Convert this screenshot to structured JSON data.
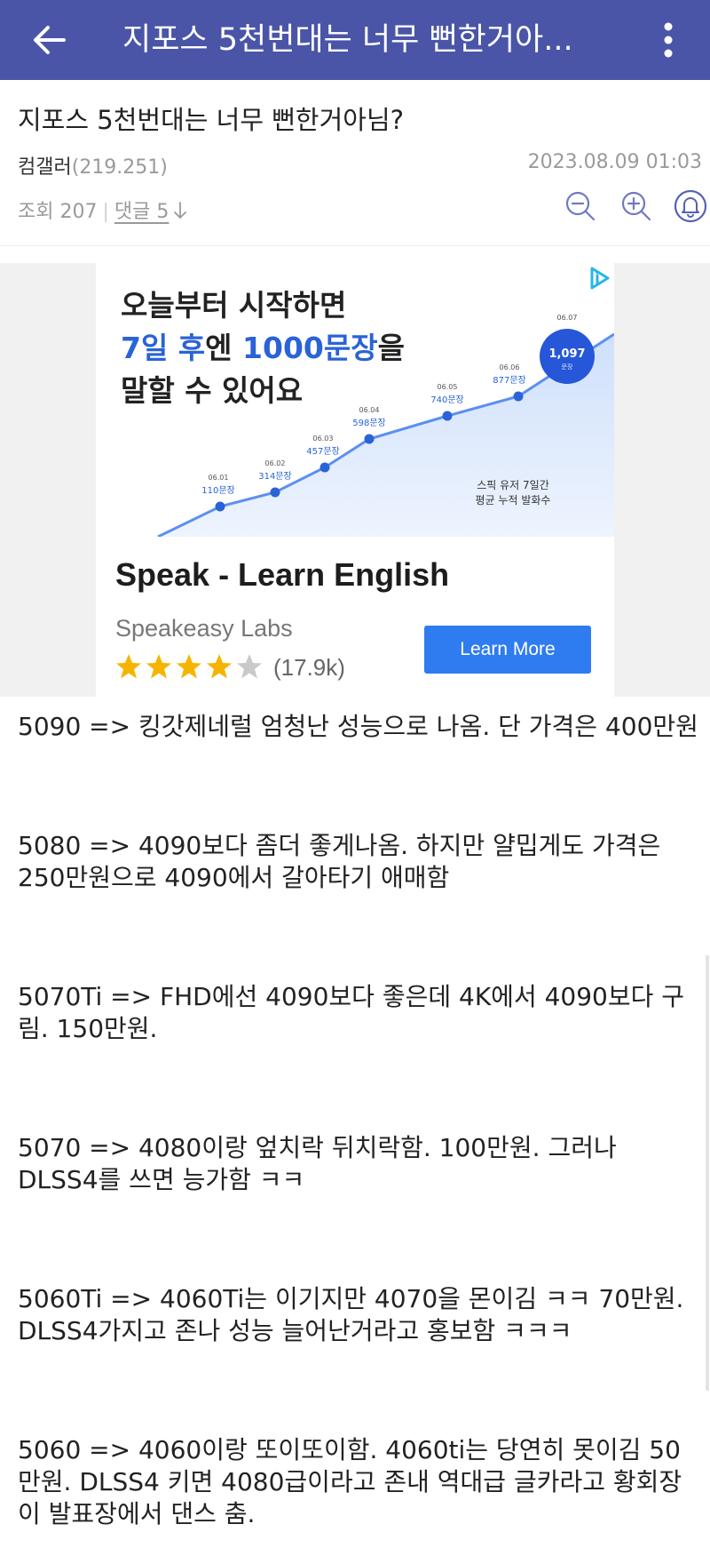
{
  "header": {
    "title": "지포스 5천번대는 너무 뻔한거아...",
    "bg_color": "#4a55a8"
  },
  "post": {
    "title": "지포스 5천번대는 너무 뻔한거아님?",
    "author": "컴갤러",
    "author_points": "(219.251)",
    "date": "2023.08.09 01:03",
    "views": "조회 207",
    "comments": "댓글 5",
    "comments_icon": "arrow-down-icon"
  },
  "toolbar_icons": [
    "zoom-out-icon",
    "zoom-in-icon",
    "bell-icon"
  ],
  "ad": {
    "headline_line1": "오늘부터 시작하면",
    "headline_line2_a": "7일 후",
    "headline_line2_b": "엔 ",
    "headline_line2_c": "1000문장",
    "headline_line2_d": "을",
    "headline_line3": "말할 수 있어요",
    "chart_points": [
      {
        "date": "06.01",
        "label": "110문장"
      },
      {
        "date": "06.02",
        "label": "314문장"
      },
      {
        "date": "06.03",
        "label": "457문장"
      },
      {
        "date": "06.04",
        "label": "598문장"
      },
      {
        "date": "06.05",
        "label": "740문장"
      },
      {
        "date": "06.06",
        "label": "877문장"
      },
      {
        "date": "06.07",
        "label": "1,097"
      }
    ],
    "bubble_sub": "문장",
    "caption_line1": "스픽 유저 7일간",
    "caption_line2": "평균 누적 발화수",
    "app_name": "Speak - Learn English",
    "developer": "Speakeasy Labs",
    "rating_count": "(17.9k)",
    "star_rating": 4.5,
    "cta": "Learn More",
    "accent_color": "#2a63d8"
  },
  "body": [
    "5090 => 킹갓제네럴 엄청난 성능으로 나옴. 단 가격은 400만원",
    "5080 => 4090보다 좀더 좋게나옴. 하지만 얄밉게도 가격은 250만원으로 4090에서 갈아타기 애매함",
    "5070Ti => FHD에선 4090보다 좋은데 4K에서 4090보다 구림. 150만원.",
    "5070 => 4080이랑 엎치락 뒤치락함. 100만원. 그러나 DLSS4를 쓰면 능가함 ㅋㅋ",
    "5060Ti => 4060Ti는 이기지만 4070을 몬이김 ㅋㅋ 70만원. DLSS4가지고 존나 성능 늘어난거라고 홍보함 ㅋㅋㅋ",
    "5060 => 4060이랑 또이또이함. 4060ti는 당연히 못이김 50만원. DLSS4 키면 4080급이라고 존내 역대급 글카라고 황회장이 발표장에서 댄스 춤."
  ]
}
